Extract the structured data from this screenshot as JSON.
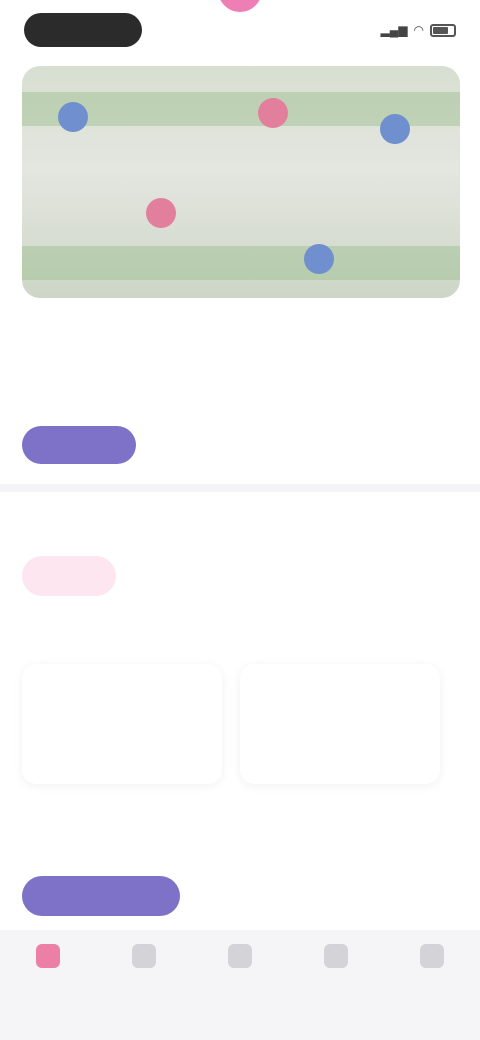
{
  "status_bar": {
    "time": "",
    "signal_label": "",
    "battery_label": ""
  },
  "hero": {
    "image_alt": ""
  },
  "content": {
    "tag": "",
    "title": "",
    "description": "",
    "primary_button": ""
  },
  "section": {
    "label": "",
    "chips": [
      {
        "label": ""
      },
      {
        "label": ""
      },
      {
        "label": ""
      }
    ],
    "subheading": "",
    "cards": [
      {
        "title": "",
        "body": ""
      },
      {
        "title": "",
        "body": ""
      }
    ]
  },
  "cta": {
    "label": ""
  },
  "tabbar": {
    "items": [
      {
        "label": "",
        "icon": "home-icon"
      },
      {
        "label": "",
        "icon": "search-icon"
      },
      {
        "label": "",
        "icon": "add-icon"
      },
      {
        "label": "",
        "icon": "chat-icon"
      },
      {
        "label": "",
        "icon": "profile-icon"
      }
    ]
  },
  "colors": {
    "accent": "#7d72c7",
    "pink": "#d6528b",
    "marker_blue": "#6f8fcf",
    "marker_pink": "#e27f9d"
  }
}
